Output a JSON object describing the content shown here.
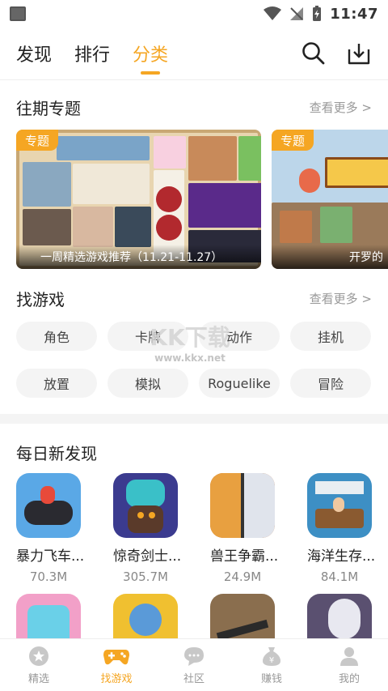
{
  "status": {
    "time": "11:47"
  },
  "top_nav": {
    "tabs": [
      {
        "label": "发现"
      },
      {
        "label": "排行"
      },
      {
        "label": "分类"
      }
    ],
    "active": "分类"
  },
  "topics": {
    "title": "往期专题",
    "see_more": "查看更多 >",
    "banners": [
      {
        "tag": "专题",
        "caption": "一周精选游戏推荐（11.21-11.27）"
      },
      {
        "tag": "专题",
        "caption": "开罗的"
      }
    ]
  },
  "find_games": {
    "title": "找游戏",
    "see_more": "查看更多 >",
    "chips": [
      "角色",
      "卡牌",
      "动作",
      "挂机",
      "放置",
      "模拟",
      "Roguelike",
      "冒险"
    ]
  },
  "watermark": {
    "text": "KK下载",
    "url": "www.kkx.net"
  },
  "daily": {
    "title": "每日新发现",
    "apps": [
      {
        "name": "暴力飞车...",
        "size": "70.3M",
        "color": "#5aa8e6"
      },
      {
        "name": "惊奇剑士...",
        "size": "305.7M",
        "color": "#3b3b8f"
      },
      {
        "name": "兽王争霸...",
        "size": "24.9M",
        "color": "#c46a2a"
      },
      {
        "name": "海洋生存...",
        "size": "84.1M",
        "color": "#3d8fc4"
      }
    ],
    "apps_row2": [
      {
        "color": "#f2a0c8"
      },
      {
        "color": "#f0c030"
      },
      {
        "color": "#8a6e4e"
      },
      {
        "color": "#5a5070"
      }
    ]
  },
  "bottom_nav": {
    "items": [
      {
        "label": "精选"
      },
      {
        "label": "找游戏"
      },
      {
        "label": "社区"
      },
      {
        "label": "赚钱"
      },
      {
        "label": "我的"
      }
    ],
    "active": "找游戏"
  },
  "colors": {
    "accent": "#f5a623",
    "muted": "#999999"
  }
}
